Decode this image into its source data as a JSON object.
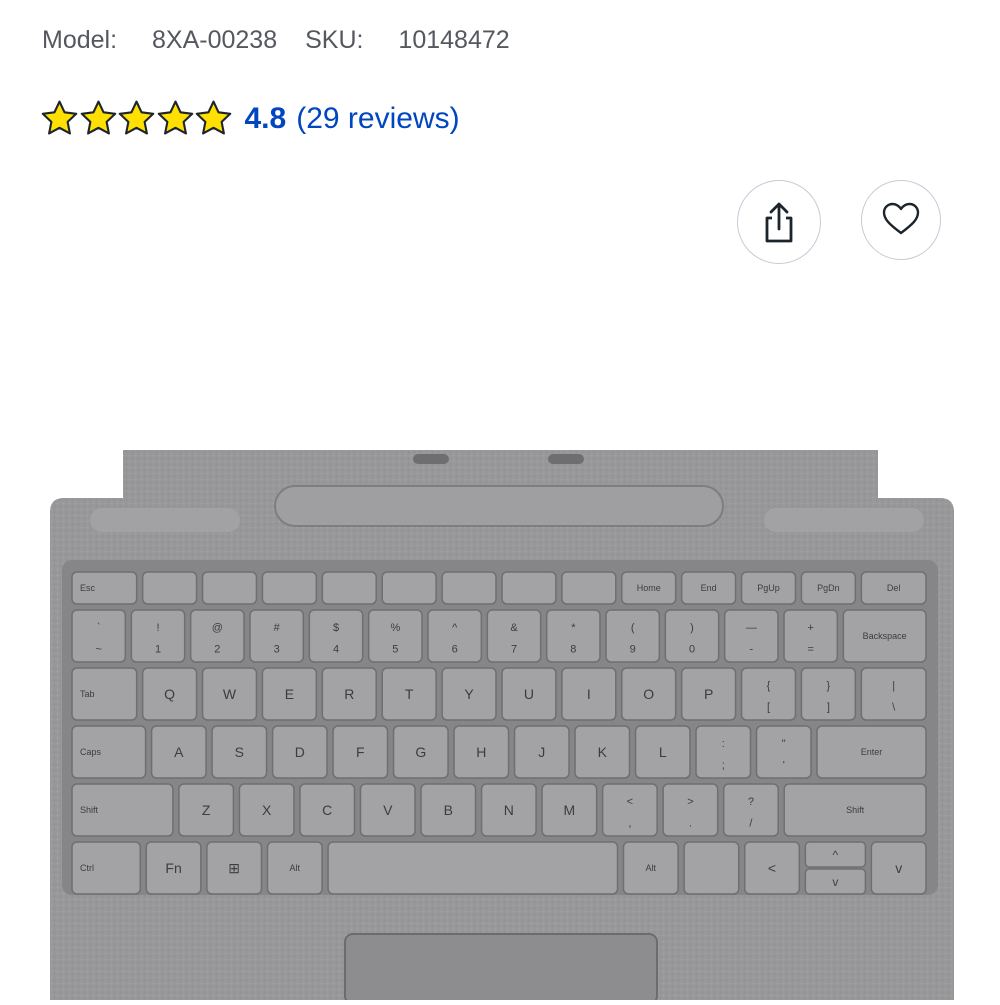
{
  "product": {
    "model_label": "Model:",
    "model_value": "8XA-00238",
    "sku_label": "SKU:",
    "sku_value": "10148472"
  },
  "rating": {
    "stars": 5,
    "score": "4.8",
    "reviews_text": "(29 reviews)",
    "star_color": "#ffe000",
    "link_color": "#0046be"
  },
  "keyboard": {
    "rows": [
      [
        "Esc",
        "",
        "",
        "",
        "",
        "",
        "",
        "",
        "",
        "Home",
        "End",
        "PgUp",
        "PgDn",
        "Del"
      ],
      [
        "` ~",
        "! 1",
        "@ 2",
        "# 3",
        "$ 4",
        "% 5",
        "^ 6",
        "& 7",
        "* 8",
        "( 9",
        ") 0",
        "— -",
        "+ =",
        "Backspace"
      ],
      [
        "Tab",
        "Q",
        "W",
        "E",
        "R",
        "T",
        "Y",
        "U",
        "I",
        "O",
        "P",
        "{ [",
        "} ]",
        "| \\"
      ],
      [
        "Caps",
        "A",
        "S",
        "D",
        "F",
        "G",
        "H",
        "J",
        "K",
        "L",
        ": ;",
        "\" '",
        "Enter"
      ],
      [
        "Shift",
        "Z",
        "X",
        "C",
        "V",
        "B",
        "N",
        "M",
        "< ,",
        "> .",
        "? /",
        "Shift"
      ],
      [
        "Ctrl",
        "Fn",
        "⊞",
        "Alt",
        "",
        "Alt",
        "",
        "<",
        "^",
        "v",
        ">"
      ]
    ]
  }
}
